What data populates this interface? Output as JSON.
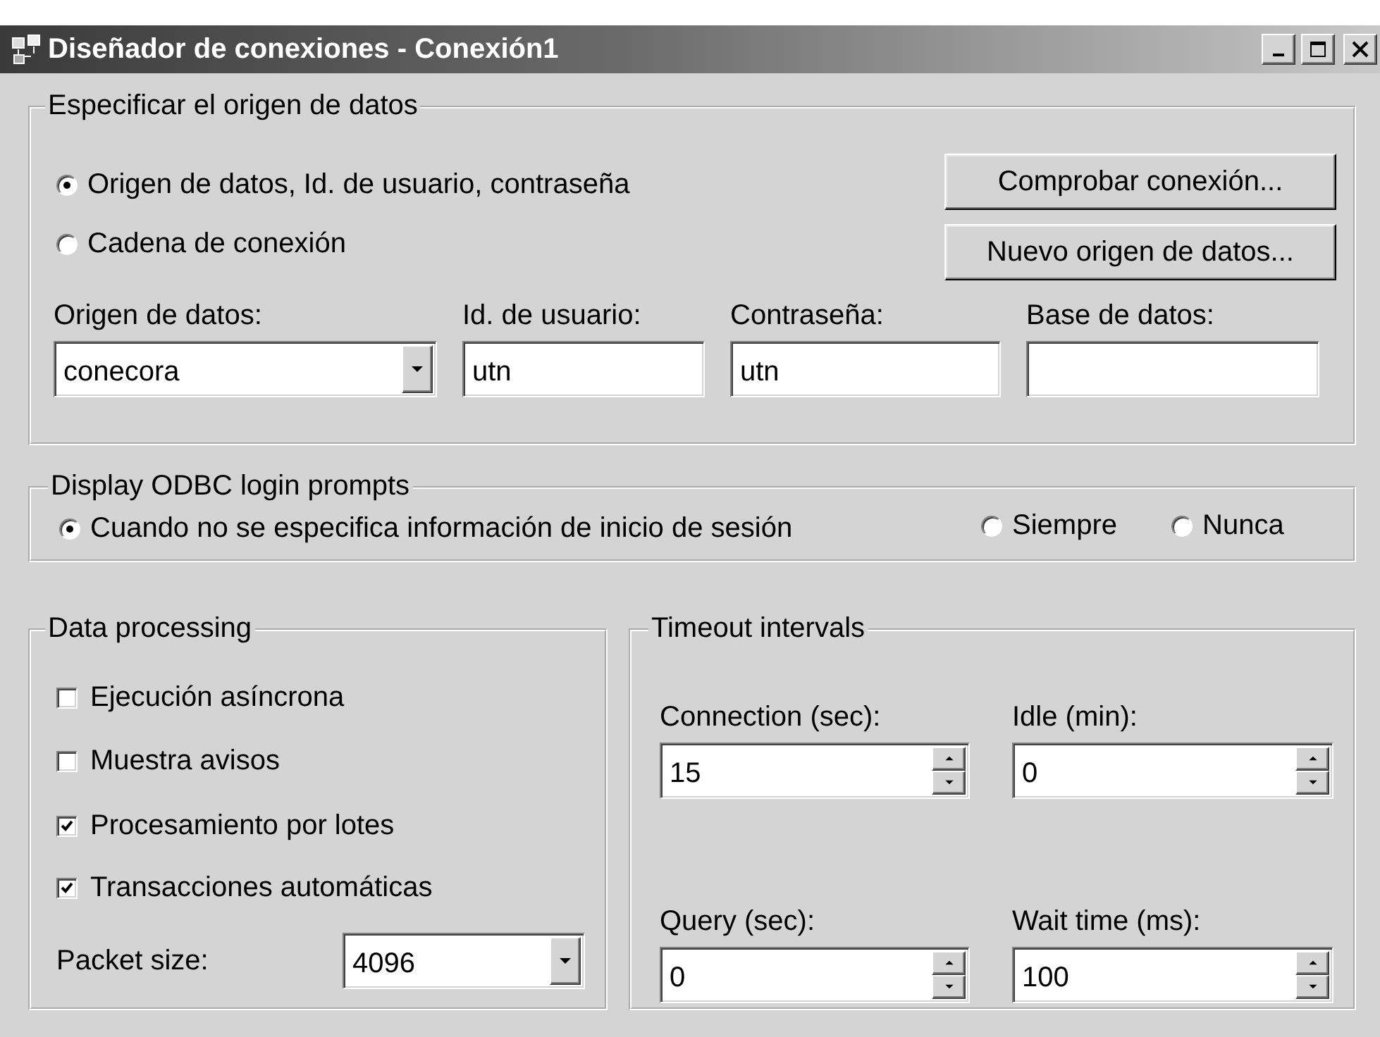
{
  "window": {
    "title": "Diseñador de conexiones - Conexión1"
  },
  "data_source": {
    "legend": "Especificar el origen de datos",
    "options": [
      {
        "label": "Origen de datos, Id. de usuario, contraseña",
        "selected": true
      },
      {
        "label": "Cadena de conexión",
        "selected": false
      }
    ],
    "buttons": [
      "Comprobar conexión...",
      "Nuevo origen de datos..."
    ],
    "fields": [
      {
        "kind": "combo",
        "label": "Origen de datos:",
        "value": "conecora"
      },
      {
        "kind": "text",
        "label": "Id. de usuario:",
        "value": "utn"
      },
      {
        "kind": "text",
        "label": "Contraseña:",
        "value": "utn"
      },
      {
        "kind": "text",
        "label": "Base de datos:"
      }
    ]
  },
  "login_prompts": {
    "legend": "Display ODBC login prompts",
    "options": [
      {
        "label": "Cuando no se especifica información de inicio de sesión",
        "selected": true
      },
      {
        "label": "Siempre",
        "selected": false
      },
      {
        "label": "Nunca",
        "selected": false
      }
    ]
  },
  "data_processing": {
    "legend": "Data processing",
    "options": [
      {
        "label": "Ejecución asíncrona",
        "checked": false
      },
      {
        "label": "Muestra avisos",
        "checked": false
      },
      {
        "label": "Procesamiento por lotes",
        "checked": true
      },
      {
        "label": "Transacciones automáticas",
        "checked": true
      }
    ],
    "packet_size": {
      "label": "Packet size:",
      "value": "4096"
    }
  },
  "timeouts": {
    "legend": "Timeout intervals",
    "fields": [
      {
        "label": "Connection (sec):",
        "value": "15"
      },
      {
        "label": "Idle (min):",
        "value": "0"
      },
      {
        "label": "Query (sec):",
        "value": "0"
      },
      {
        "label": "Wait time (ms):",
        "value": "100"
      }
    ]
  }
}
